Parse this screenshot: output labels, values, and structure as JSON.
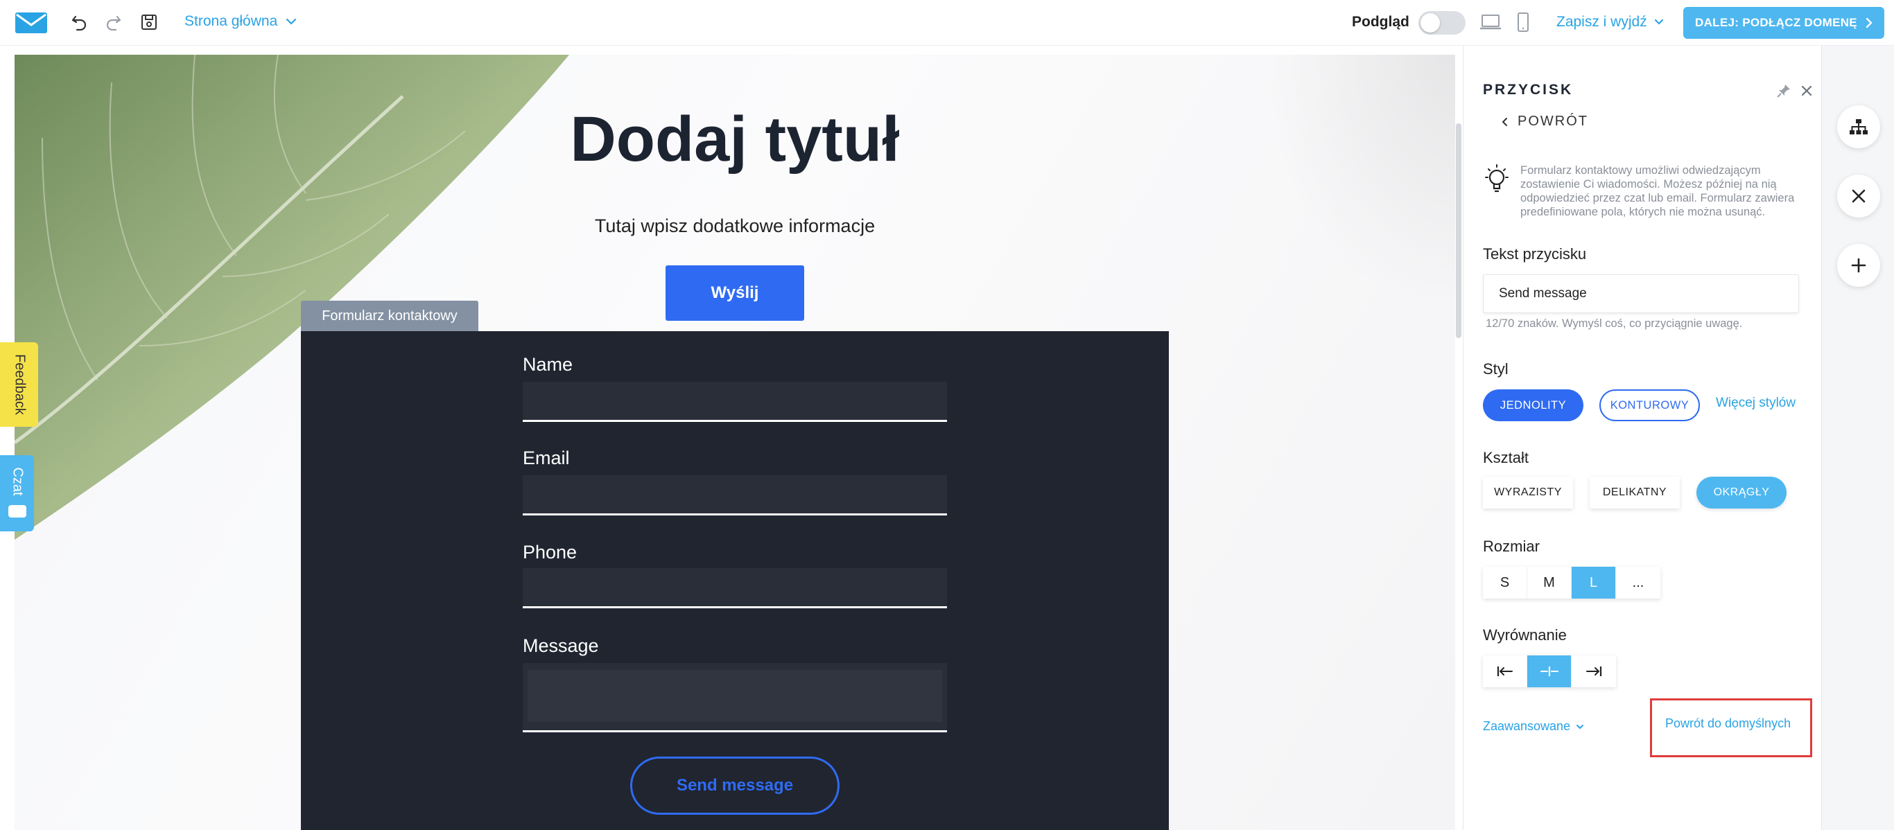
{
  "topbar": {
    "page_name": "Strona główna",
    "preview_label": "Podgląd",
    "preview_enabled": false,
    "save_exit_label": "Zapisz i wyjdź",
    "next_label": "DALEJ: PODŁĄCZ DOMENĘ",
    "icons": [
      "logo-envelope-icon",
      "undo-icon",
      "redo-icon",
      "save-icon",
      "chevron-down-icon",
      "desktop-icon",
      "mobile-icon",
      "chevron-right-icon"
    ]
  },
  "canvas": {
    "title": "Dodaj tytuł",
    "subtitle": "Tutaj wpisz dodatkowe informacje",
    "hero_button": "Wyślij",
    "form_tag": "Formularz kontaktowy",
    "fields": [
      {
        "label": "Name"
      },
      {
        "label": "Email"
      },
      {
        "label": "Phone"
      },
      {
        "label": "Message"
      }
    ],
    "submit_label": "Send message"
  },
  "side_tabs": {
    "feedback": "Feedback",
    "chat": "Czat"
  },
  "panel": {
    "title": "PRZYCISK",
    "back_label": "POWRÓT",
    "info": "Formularz kontaktowy umożliwi odwiedzającym zostawienie Ci wiadomości. Możesz później na nią odpowiedzieć przez czat lub email. Formularz zawiera predefiniowane pola, których nie można usunąć.",
    "button_text_label": "Tekst przycisku",
    "button_text_value": "Send message",
    "char_hint": "12/70 znaków. Wymyśl coś, co przyciągnie uwagę.",
    "style_label": "Styl",
    "style_solid": "JEDNOLITY",
    "style_outline": "KONTUROWY",
    "more_styles": "Więcej stylów",
    "shape_label": "Kształt",
    "shapes": [
      "WYRAZISTY",
      "DELIKATNY",
      "OKRĄGŁY"
    ],
    "shape_selected": "OKRĄGŁY",
    "size_label": "Rozmiar",
    "sizes": [
      "S",
      "M",
      "L",
      "..."
    ],
    "size_selected": "L",
    "align_label": "Wyrównanie",
    "align_options": [
      "left",
      "center",
      "right"
    ],
    "align_selected": "center",
    "advanced_label": "Zaawansowane",
    "reset_label": "Powrót do domyślnych"
  },
  "rail": {
    "icons": [
      "sitemap-icon",
      "close-icon",
      "plus-icon"
    ]
  },
  "colors": {
    "accent": "#29a3e3",
    "primary_button": "#2f6bf2",
    "active_light": "#4eb7f0",
    "form_bg": "#202530",
    "highlight_box": "#e03c3c"
  }
}
